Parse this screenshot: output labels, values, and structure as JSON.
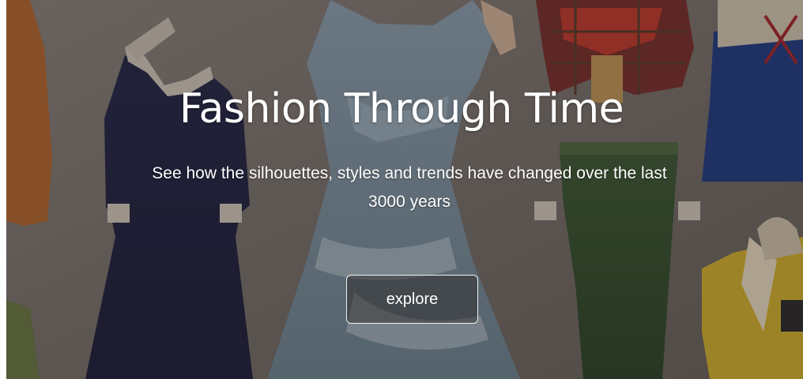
{
  "hero": {
    "title": "Fashion Through Time",
    "subtitle_line1": "See how the silhouettes, styles and trends have changed over the last",
    "subtitle_line2": "3000 years",
    "explore_label": "explore"
  },
  "colors": {
    "text": "#ffffff",
    "button_border": "#f2f2f2",
    "backdrop_base": "#6e6762"
  },
  "background_art": {
    "description_icon": "paper-doll-dresses-illustration"
  }
}
